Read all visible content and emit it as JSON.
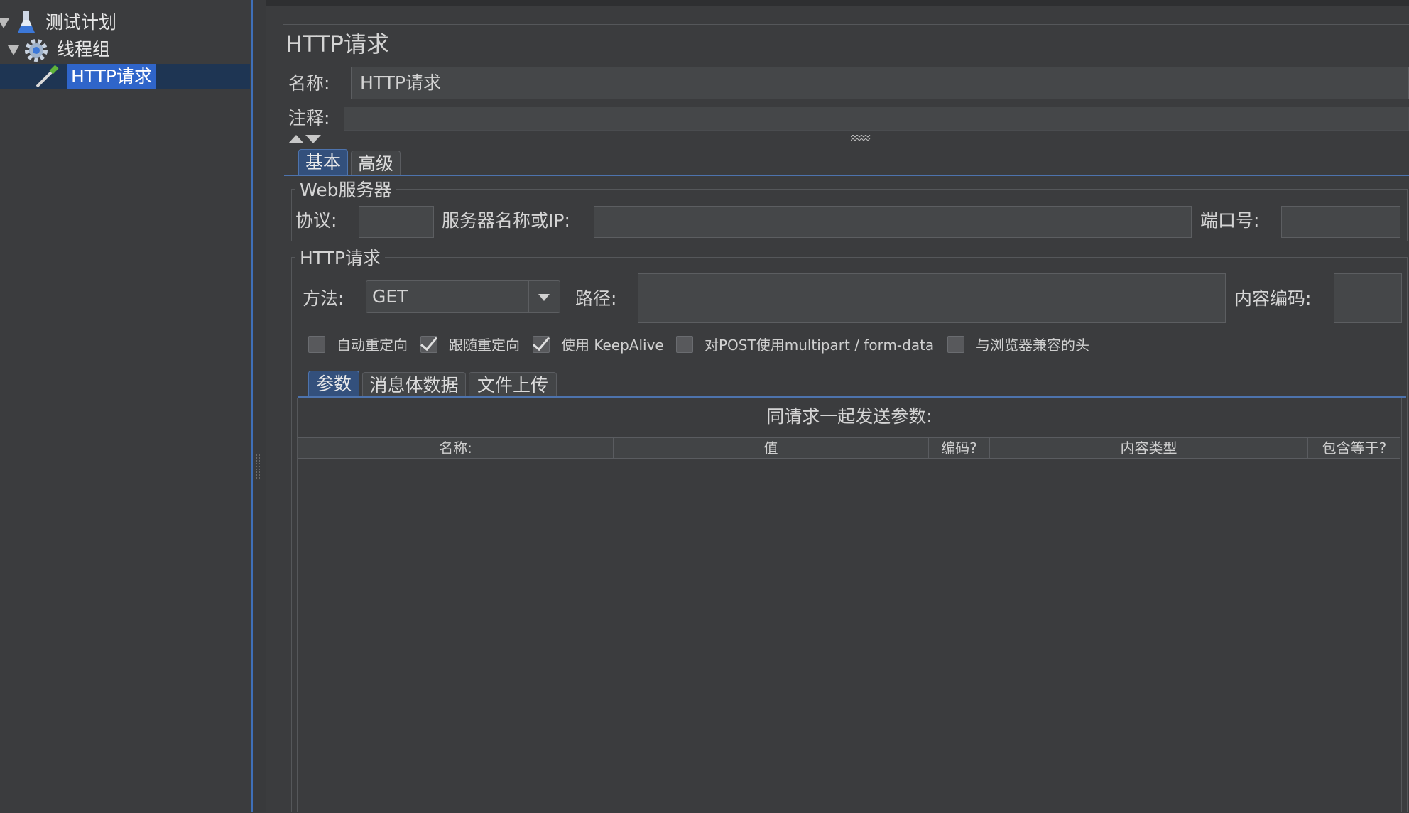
{
  "tree": {
    "items": [
      {
        "label": "测试计划",
        "icon": "flask-icon"
      },
      {
        "label": "线程组",
        "icon": "gear-icon"
      },
      {
        "label": "HTTP请求",
        "icon": "pipette-icon"
      }
    ]
  },
  "panel": {
    "title": "HTTP请求",
    "name_label": "名称:",
    "name_value": "HTTP请求",
    "comment_label": "注释:",
    "comment_value": ""
  },
  "tabs": {
    "basic": "基本",
    "advanced": "高级"
  },
  "web_server": {
    "title": "Web服务器",
    "protocol_label": "协议:",
    "protocol_value": "",
    "server_label": "服务器名称或IP:",
    "server_value": "",
    "port_label": "端口号:",
    "port_value": ""
  },
  "http_request": {
    "title": "HTTP请求",
    "method_label": "方法:",
    "method_value": "GET",
    "path_label": "路径:",
    "path_value": "",
    "encoding_label": "内容编码:",
    "encoding_value": ""
  },
  "options": [
    {
      "label": "自动重定向",
      "checked": false
    },
    {
      "label": "跟随重定向",
      "checked": true
    },
    {
      "label": "使用 KeepAlive",
      "checked": true
    },
    {
      "label": "对POST使用multipart / form-data",
      "checked": false
    },
    {
      "label": "与浏览器兼容的头",
      "checked": false
    }
  ],
  "sub_tabs": {
    "params": "参数",
    "body": "消息体数据",
    "files": "文件上传"
  },
  "params_table": {
    "caption": "同请求一起发送参数:",
    "columns": [
      "名称:",
      "值",
      "编码?",
      "内容类型",
      "包含等于?"
    ]
  },
  "colors": {
    "background": "#3b3c3e",
    "selection": "#2f65ca",
    "active_tab": "#33507c"
  }
}
